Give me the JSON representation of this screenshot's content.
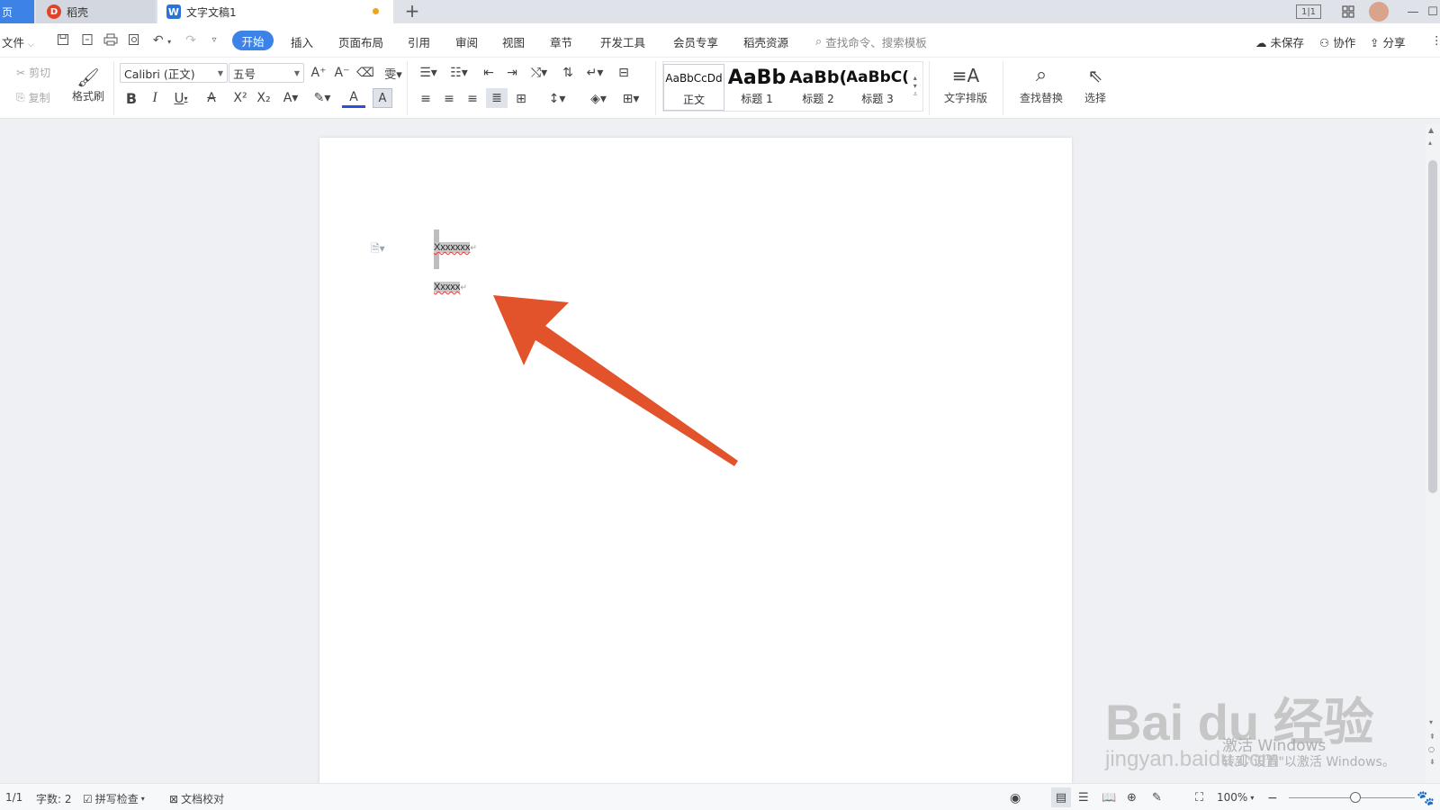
{
  "titlebar": {
    "home_tab": "页",
    "daoke_tab": "稻壳",
    "doc_tab": "文字文稿1",
    "new_tab": "+",
    "layout_icon": "1|1",
    "minimize": "—",
    "maximize": "☐"
  },
  "menu": {
    "file": "文件",
    "items": [
      "开始",
      "插入",
      "页面布局",
      "引用",
      "审阅",
      "视图",
      "章节",
      "开发工具",
      "会员专享",
      "稻壳资源"
    ],
    "search_placeholder": "查找命令、搜索模板",
    "unsaved": "未保存",
    "collaborate": "协作",
    "share": "分享"
  },
  "ribbon": {
    "cut": "剪切",
    "copy": "复制",
    "format_painter": "格式刷",
    "font_name": "Calibri (正文)",
    "font_size": "五号",
    "bold": "B",
    "italic": "I",
    "underline": "U",
    "styles": [
      {
        "sample": "AaBbCcDd",
        "name": "正文"
      },
      {
        "sample": "AaBb",
        "name": "标题 1"
      },
      {
        "sample": "AaBb(",
        "name": "标题 2"
      },
      {
        "sample": "AaBbC(",
        "name": "标题 3"
      }
    ],
    "text_layout": "文字排版",
    "find_replace": "查找替换",
    "select": "选择"
  },
  "document": {
    "line1": "Xxxxxxx",
    "line2": "Xxxxx",
    "para_mark": "↵"
  },
  "arrow_color": "#e2522b",
  "status": {
    "page": "1/1",
    "word_count": "字数: 2",
    "spell_check": "拼写检查",
    "proofread": "文档校对",
    "zoom": "100%"
  },
  "watermark": {
    "logo": "Bai du 经验",
    "url": "jingyan.baidu.com",
    "activate": "激活 Windows",
    "activate_sub": "转到\"设置\"以激活 Windows。"
  }
}
